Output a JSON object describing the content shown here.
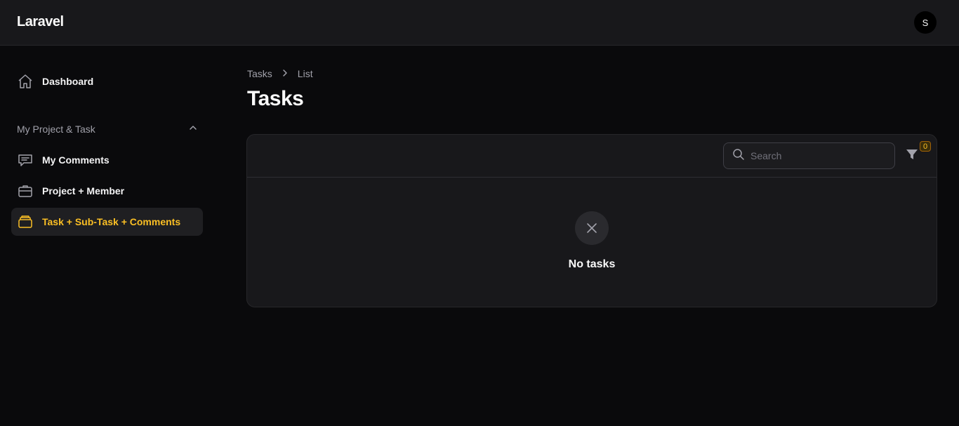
{
  "app": {
    "brand": "Laravel",
    "user_initial": "S"
  },
  "sidebar": {
    "dashboard": "Dashboard",
    "group_label": "My Project & Task",
    "items": [
      {
        "label": "My Comments",
        "icon": "chat-bubble-icon"
      },
      {
        "label": "Project + Member",
        "icon": "briefcase-icon"
      },
      {
        "label": "Task + Sub-Task + Comments",
        "icon": "stack-icon",
        "active": true
      }
    ]
  },
  "breadcrumb": {
    "parent": "Tasks",
    "current": "List"
  },
  "page": {
    "title": "Tasks"
  },
  "table": {
    "search_placeholder": "Search",
    "filter_count": "0",
    "empty_text": "No tasks"
  },
  "colors": {
    "accent": "#fbbf24",
    "background": "#0a0a0c",
    "surface": "#18181b"
  }
}
